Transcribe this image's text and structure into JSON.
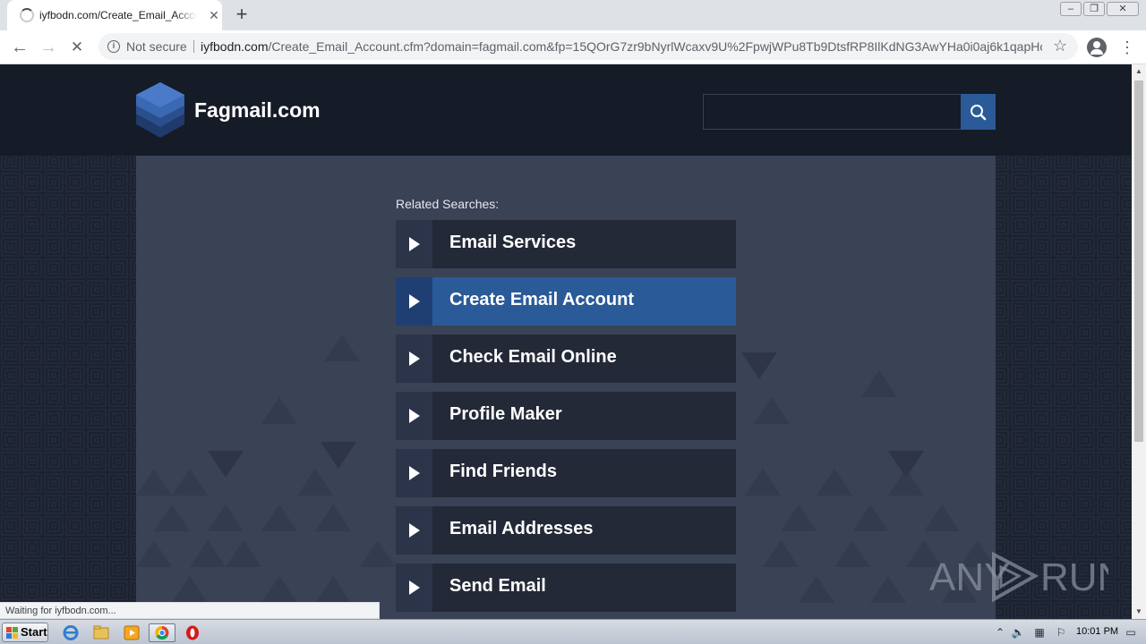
{
  "browser": {
    "tab": {
      "title": "iyfbodn.com/Create_Email_Account.cfm?domain=fagmail.com",
      "close_glyph": "✕"
    },
    "new_tab_glyph": "+",
    "window_controls": {
      "minimize": "–",
      "restore": "❐",
      "close": "✕"
    },
    "toolbar": {
      "back_glyph": "←",
      "forward_glyph": "→",
      "stop_glyph": "✕",
      "security_label": "Not secure",
      "url_host": "iyfbodn.com",
      "url_path": "/Create_Email_Account.cfm?domain=fagmail.com&fp=15QOrG7zr9bNyrlWcaxv9U%2FpwjWPu8Tb9DtsfRP8IlKdNG3AwYHa0i0aj6k1qapHc...",
      "bookmark_glyph": "☆",
      "menu_glyph": "⋮"
    },
    "status_text": "Waiting for iyfbodn.com..."
  },
  "site": {
    "name": "Fagmail.com",
    "search": {
      "value": "",
      "placeholder": ""
    },
    "related_label": "Related Searches:",
    "related_searches": [
      {
        "label": "Email Services",
        "active": false
      },
      {
        "label": "Create Email Account",
        "active": true
      },
      {
        "label": "Check Email Online",
        "active": false
      },
      {
        "label": "Profile Maker",
        "active": false
      },
      {
        "label": "Find Friends",
        "active": false
      },
      {
        "label": "Email Addresses",
        "active": false
      },
      {
        "label": "Send Email",
        "active": false
      }
    ],
    "colors": {
      "header_bg": "#151b27",
      "panel_bg": "#3a4256",
      "item_bg": "#232937",
      "active_bg": "#2a5a98"
    }
  },
  "watermark": {
    "left": "ANY",
    "right": "RUN"
  },
  "taskbar": {
    "start_label": "Start",
    "icons": [
      "internet-explorer-icon",
      "folder-icon",
      "media-player-icon",
      "chrome-icon",
      "opera-icon"
    ],
    "clock": "10:01 PM"
  }
}
